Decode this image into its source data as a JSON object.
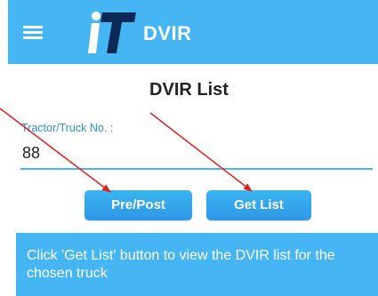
{
  "appbar": {
    "title": "DVIR",
    "logo_text": "iT",
    "menu_icon": "hamburger-menu-icon",
    "color": "#45b6f3"
  },
  "page": {
    "title": "DVIR List"
  },
  "form": {
    "tractor_label": "Tractor/Truck No. :",
    "tractor_value": "88"
  },
  "buttons": {
    "prepost_label": "Pre/Post",
    "getlist_label": "Get List"
  },
  "info": {
    "message": "Click 'Get List' button to view the DVIR list for the chosen truck"
  },
  "annotation": {
    "arrow_color": "#e0201b"
  }
}
